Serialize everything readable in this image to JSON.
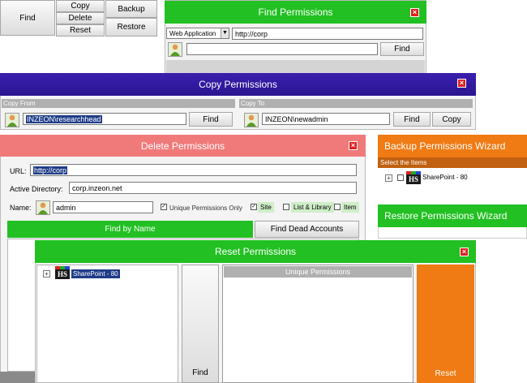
{
  "toolbar": {
    "find": "Find",
    "copy": "Copy",
    "delete": "Delete",
    "reset": "Reset",
    "backup": "Backup",
    "restore": "Restore"
  },
  "find_window": {
    "title": "Find Permissions",
    "close": "×",
    "scope_selected": "Web Application",
    "url": "http://corp",
    "user": "",
    "find_button": "Find"
  },
  "copy_window": {
    "title": "Copy Permissions",
    "close": "×",
    "copy_from_label": "Copy From",
    "copy_to_label": "Copy To",
    "from_user": "INZEON\\researchhead",
    "to_user": "INZEON\\newadmin",
    "find_from": "Find",
    "find_to": "Find",
    "copy_button": "Copy"
  },
  "delete_window": {
    "title": "Delete Permissions",
    "close": "×",
    "url_label": "URL:",
    "url_value": "http://corp",
    "ad_label": "Active Directory:",
    "ad_value": "corp.inzeon.net",
    "name_label": "Name:",
    "name_value": "admin",
    "unique_only": "Unique Permissions Only",
    "site": "Site",
    "list_library": "List & Library",
    "item": "Item",
    "find_by_name": "Find by Name",
    "find_dead": "Find Dead Accounts"
  },
  "backup_window": {
    "title": "Backup Permissions Wizard",
    "select_items": "Select the Items",
    "tree_item": "SharePoint - 80"
  },
  "restore_window": {
    "title": "Restore Permissions Wizard"
  },
  "reset_window": {
    "title": "Reset Permissions",
    "close": "×",
    "tree_item": "SharePoint - 80",
    "unique_header": "Unique Permissions",
    "find_button": "Find",
    "reset_button": "Reset"
  },
  "colors": {
    "green": "#22c022",
    "blue": "#3a1fae",
    "salmon": "#f07a7a",
    "orange": "#f07a14"
  }
}
